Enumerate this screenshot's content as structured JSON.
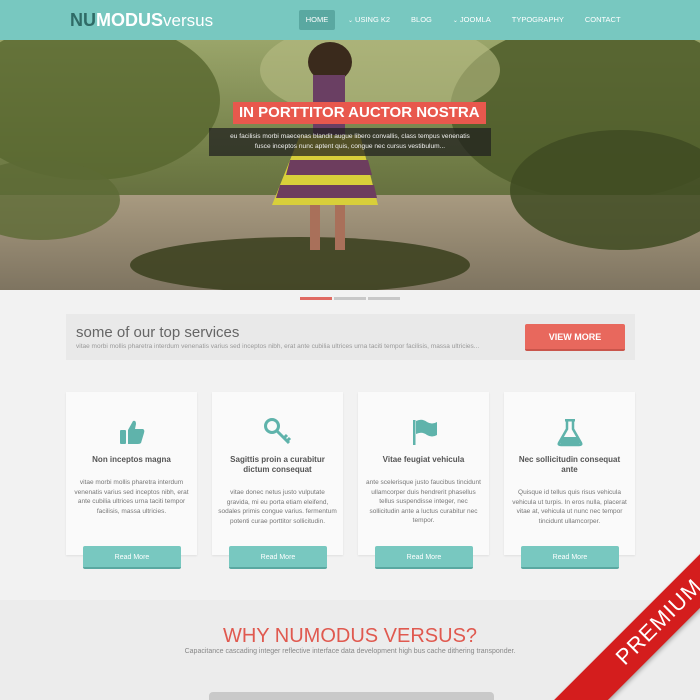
{
  "logo": {
    "nu": "NU",
    "modus": "MODUS",
    "versus": "versus"
  },
  "nav": [
    {
      "label": "HOME",
      "caret": ""
    },
    {
      "label": "USING K2",
      "caret": "⌄"
    },
    {
      "label": "BLOG",
      "caret": ""
    },
    {
      "label": "JOOMLA",
      "caret": "⌄"
    },
    {
      "label": "TYPOGRAPHY",
      "caret": ""
    },
    {
      "label": "CONTACT",
      "caret": ""
    }
  ],
  "hero": {
    "title": "IN PORTTITOR AUCTOR NOSTRA",
    "subtitle_line1": "eu facilisis morbi maecenas blandit augue libero convallis, class tempus venenatis",
    "subtitle_line2": "fusce inceptos nunc aptent quis, congue nec cursus vestibulum..."
  },
  "services": {
    "title": "some of our top services",
    "subtitle": "vitae morbi mollis pharetra interdum venenatis varius sed inceptos nibh, erat ante cubilia ultrices urna taciti tempor facilisis, massa ultricies...",
    "button": "VIEW MORE"
  },
  "cards": [
    {
      "icon": "thumbs-up-icon",
      "title": "Non inceptos magna",
      "text": "vitae morbi mollis pharetra interdum venenatis varius sed inceptos nibh, erat ante cubilia ultrices urna taciti tempor facilisis, massa ultricies.",
      "button": "Read More"
    },
    {
      "icon": "key-icon",
      "title": "Sagittis proin a curabitur dictum consequat",
      "text": "vitae donec netus justo vulputate gravida, mi eu porta etiam eleifend, sodales primis congue varius. fermentum potenti curae porttitor sollicitudin.",
      "button": "Read More"
    },
    {
      "icon": "flag-icon",
      "title": "Vitae feugiat vehicula",
      "text": "ante scelerisque justo faucibus tincidunt ullamcorper duis hendrerit phasellus tellus suspendisse integer, nec sollicitudin ante a luctus curabitur nec tempor.",
      "button": "Read More"
    },
    {
      "icon": "flask-icon",
      "title": "Nec sollicitudin consequat ante",
      "text": "Quisque id tellus quis risus vehicula vehicula ut turpis. In eros nulla, placerat vitae at, vehicula ut nunc nec tempor tincidunt ullamcorper.",
      "button": "Read More"
    }
  ],
  "why": {
    "title": "WHY NUMODUS VERSUS?",
    "subtitle": "Capacitance cascading integer reflective interface data development high bus cache dithering transponder."
  },
  "ribbon": "PREMIUM",
  "colors": {
    "teal": "#78c8c0",
    "red": "#e8685d",
    "ribbon_red": "#d41d1d"
  }
}
